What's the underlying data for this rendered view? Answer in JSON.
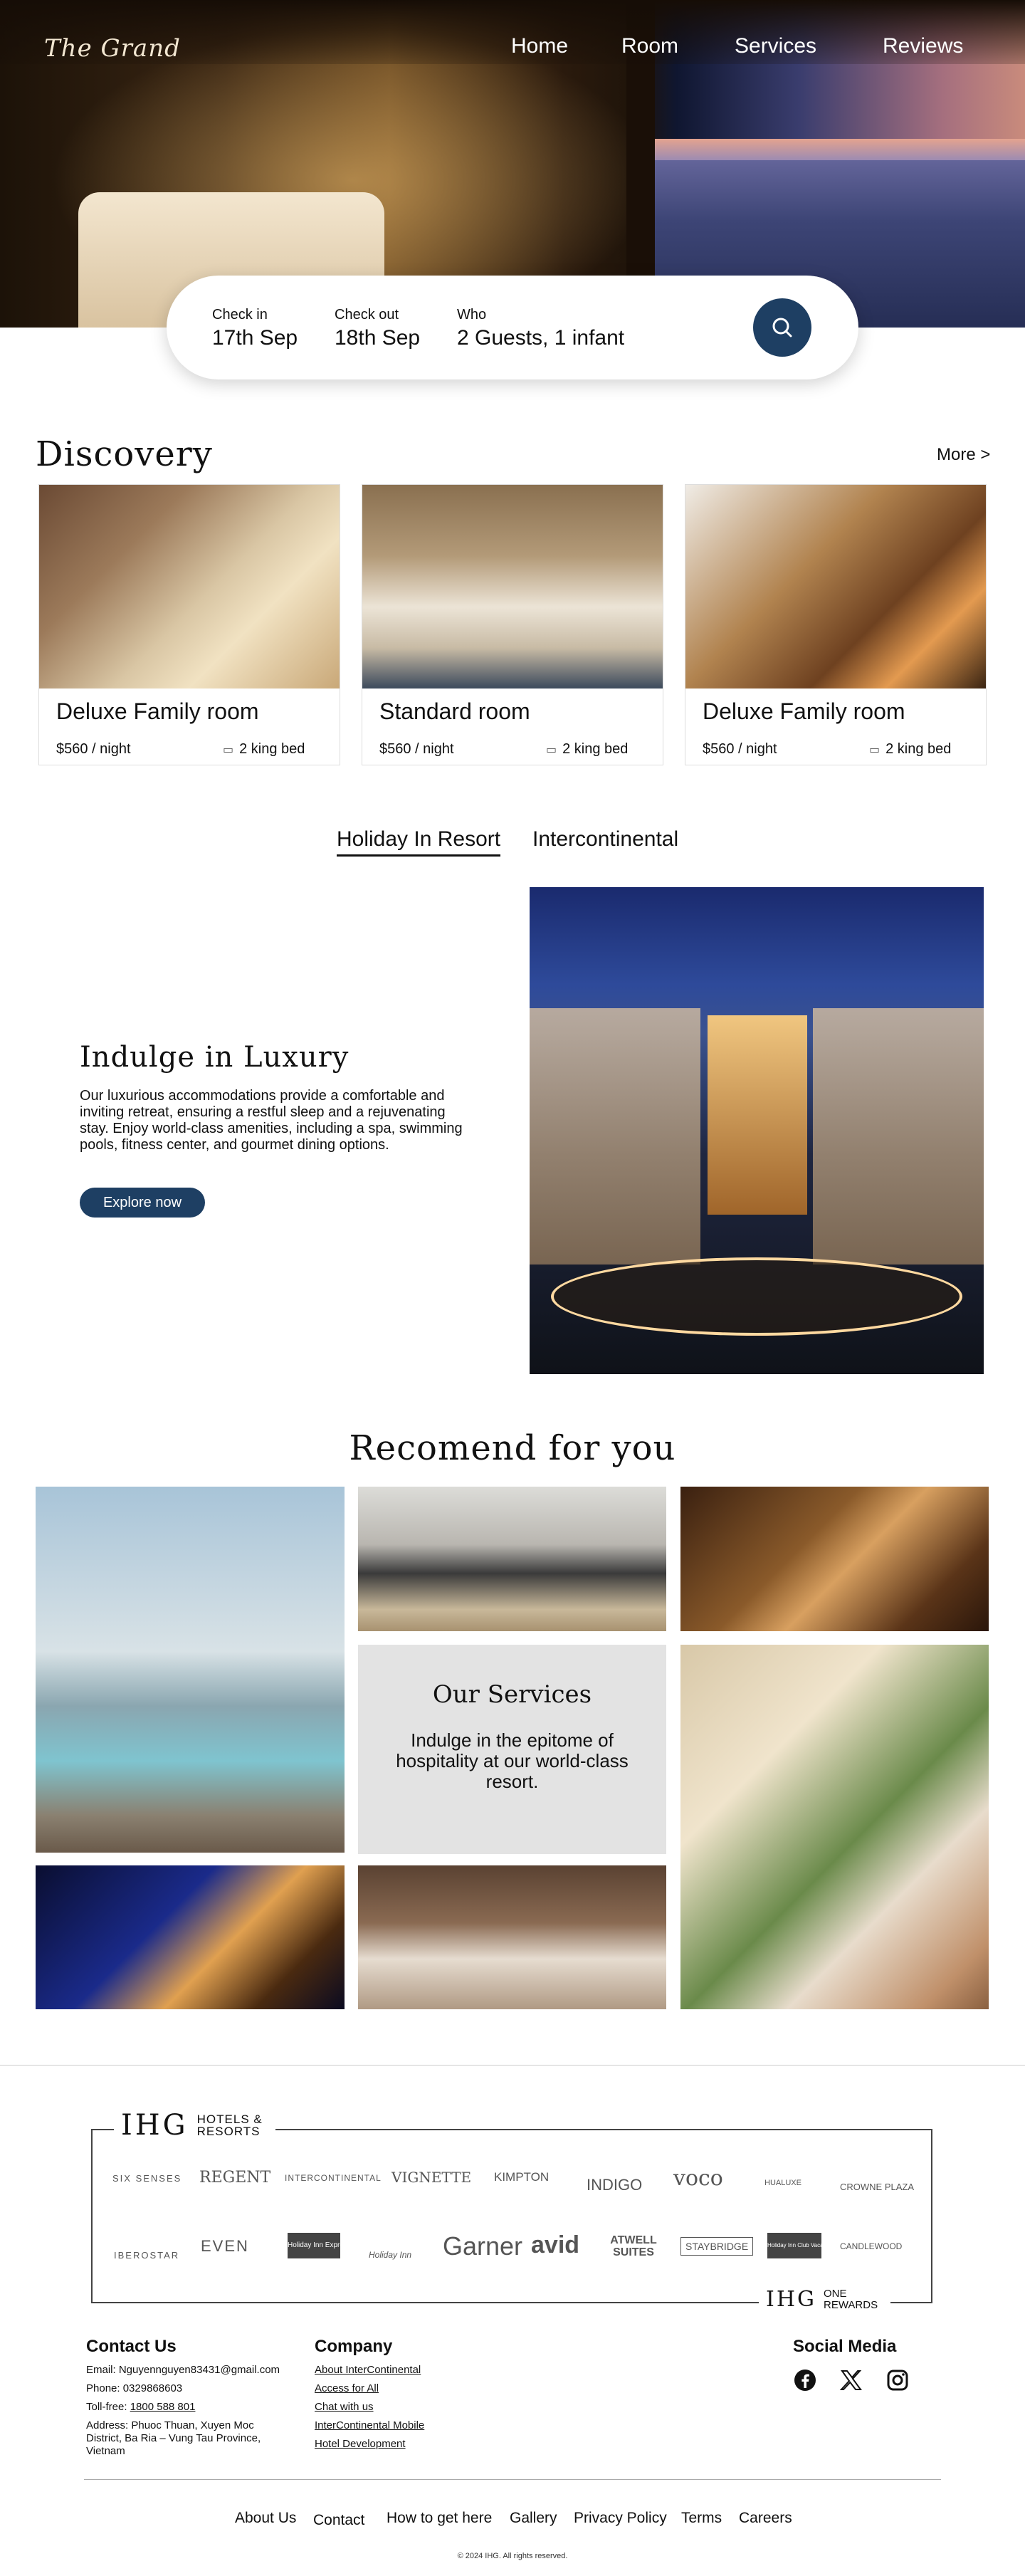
{
  "brand": "The Grand",
  "nav": [
    "Home",
    "Room",
    "Services",
    "Reviews"
  ],
  "search": {
    "checkin_label": "Check in",
    "checkin_value": "17th Sep",
    "checkout_label": "Check out",
    "checkout_value": "18th Sep",
    "who_label": "Who",
    "who_value": "2 Guests, 1 infant",
    "button_icon": "search-icon"
  },
  "discovery": {
    "title": "Discovery",
    "more": "More >",
    "cards": [
      {
        "title": "Deluxe Family room",
        "price": "$560 / night",
        "beds": "2 king bed",
        "icon": "bed-icon"
      },
      {
        "title": "Standard room",
        "price": "$560 / night",
        "beds": "2 king bed",
        "icon": "bed-icon"
      },
      {
        "title": "Deluxe Family room",
        "price": "$560 / night",
        "beds": "2 king bed",
        "icon": "bed-icon"
      }
    ]
  },
  "tabs": [
    "Holiday In Resort",
    "Intercontinental"
  ],
  "luxury": {
    "title": "Indulge in Luxury",
    "text": "Our luxurious accommodations provide a comfortable and inviting retreat, ensuring a restful sleep and a rejuvenating stay. Enjoy world-class amenities, including a spa, swimming pools, fitness center, and gourmet dining options.",
    "button": "Explore now"
  },
  "recommend": {
    "title": "Recomend for you",
    "services_title": "Our Services",
    "services_text": "Indulge in the epitome of hospitality at our world-class resort."
  },
  "ihg": {
    "logo": "IHG",
    "logo_sub": "HOTELS & RESORTS",
    "brands_row1": [
      "SIX SENSES",
      "REGENT",
      "INTERCONTINENTAL",
      "VIGNETTE",
      "KIMPTON",
      "INDIGO",
      "voco",
      "HUALUXE",
      "CROWNE PLAZA"
    ],
    "brands_row2": [
      "IBEROSTAR",
      "EVEN",
      "Holiday Inn Express",
      "Holiday Inn",
      "Garner",
      "avid",
      "ATWELL SUITES",
      "STAYBRIDGE",
      "Holiday Inn Club Vacations",
      "CANDLEWOOD"
    ],
    "rewards_logo": "IHG",
    "rewards_text": "ONE REWARDS"
  },
  "footer": {
    "contact_title": "Contact Us",
    "email": "Email: Nguyennguyen83431@gmail.com",
    "phone": "Phone: 0329868603",
    "tollfree_label": "Toll-free: ",
    "tollfree": "1800 588 801",
    "address": "Address: Phuoc Thuan, Xuyen Moc District, Ba Ria – Vung Tau Province, Vietnam",
    "company_title": "Company",
    "company_links": [
      "About InterContinental",
      "Access for All",
      "Chat with us",
      "InterContinental Mobile",
      "Hotel Development"
    ],
    "social_title": "Social Media",
    "social_icons": [
      "facebook-icon",
      "x-icon",
      "instagram-icon"
    ],
    "bottom_nav": [
      "About Us",
      "Contact",
      "How to get here",
      "Gallery",
      "Privacy Policy",
      "Terms",
      "Careers"
    ],
    "copyright": "© 2024 IHG. All rights reserved."
  }
}
